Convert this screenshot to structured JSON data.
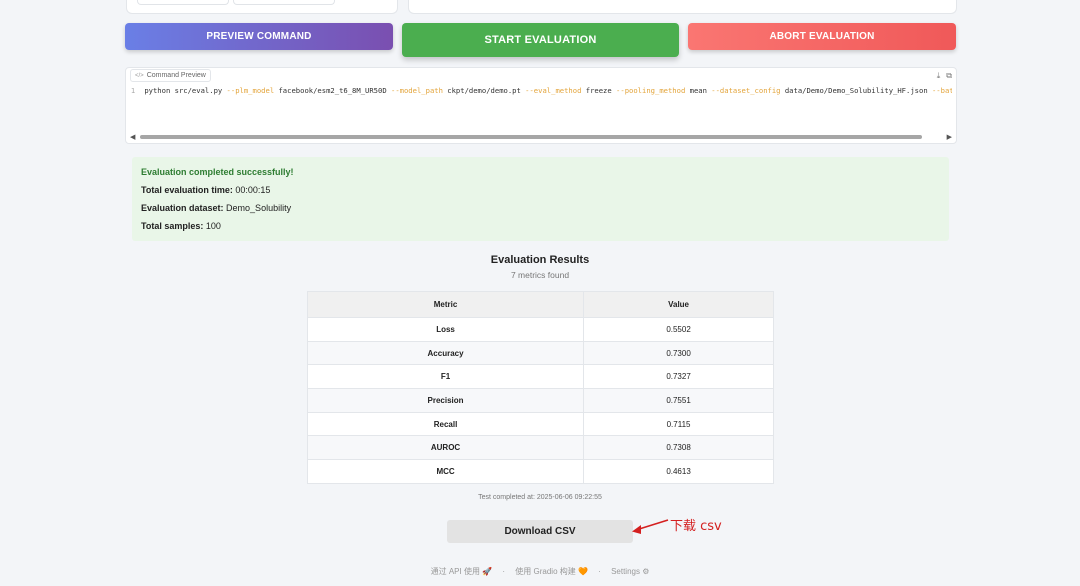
{
  "actions": {
    "preview": "PREVIEW COMMAND",
    "start": "START EVALUATION",
    "abort": "ABORT EVALUATION"
  },
  "code_preview": {
    "label": "Command Preview",
    "line_no": "1",
    "tokens": [
      {
        "t": "val",
        "s": "python src/eval.py "
      },
      {
        "t": "arg",
        "s": "--plm_model "
      },
      {
        "t": "val",
        "s": "facebook/esm2_t6_8M_UR50D "
      },
      {
        "t": "arg",
        "s": "--model_path "
      },
      {
        "t": "val",
        "s": "ckpt/demo/demo.pt "
      },
      {
        "t": "arg",
        "s": "--eval_method "
      },
      {
        "t": "val",
        "s": "freeze "
      },
      {
        "t": "arg",
        "s": "--pooling_method "
      },
      {
        "t": "val",
        "s": "mean "
      },
      {
        "t": "arg",
        "s": "--dataset_config "
      },
      {
        "t": "val",
        "s": "data/Demo/Demo_Solubility_HF.json "
      },
      {
        "t": "arg",
        "s": "--batch_si"
      }
    ]
  },
  "status": {
    "headline": "Evaluation completed successfully!",
    "time_label": "Total evaluation time:",
    "time_value": "00:00:15",
    "dataset_label": "Evaluation dataset:",
    "dataset_value": "Demo_Solubility",
    "samples_label": "Total samples:",
    "samples_value": "100"
  },
  "results": {
    "title": "Evaluation Results",
    "subtitle": "7 metrics found",
    "columns": [
      "Metric",
      "Value"
    ],
    "rows": [
      {
        "metric": "Loss",
        "value": "0.5502"
      },
      {
        "metric": "Accuracy",
        "value": "0.7300"
      },
      {
        "metric": "F1",
        "value": "0.7327"
      },
      {
        "metric": "Precision",
        "value": "0.7551"
      },
      {
        "metric": "Recall",
        "value": "0.7115"
      },
      {
        "metric": "AUROC",
        "value": "0.7308"
      },
      {
        "metric": "MCC",
        "value": "0.4613"
      }
    ],
    "timestamp": "Test completed at: 2025-06-06 09:22:55"
  },
  "download": {
    "label": "Download CSV"
  },
  "annotation": {
    "text": "下载 csv",
    "color": "#d42020"
  },
  "footer": {
    "api": "通过 API 使用 🚀",
    "sep": "·",
    "built": "使用 Gradio 构建 🧡",
    "settings": "Settings ⚙"
  }
}
